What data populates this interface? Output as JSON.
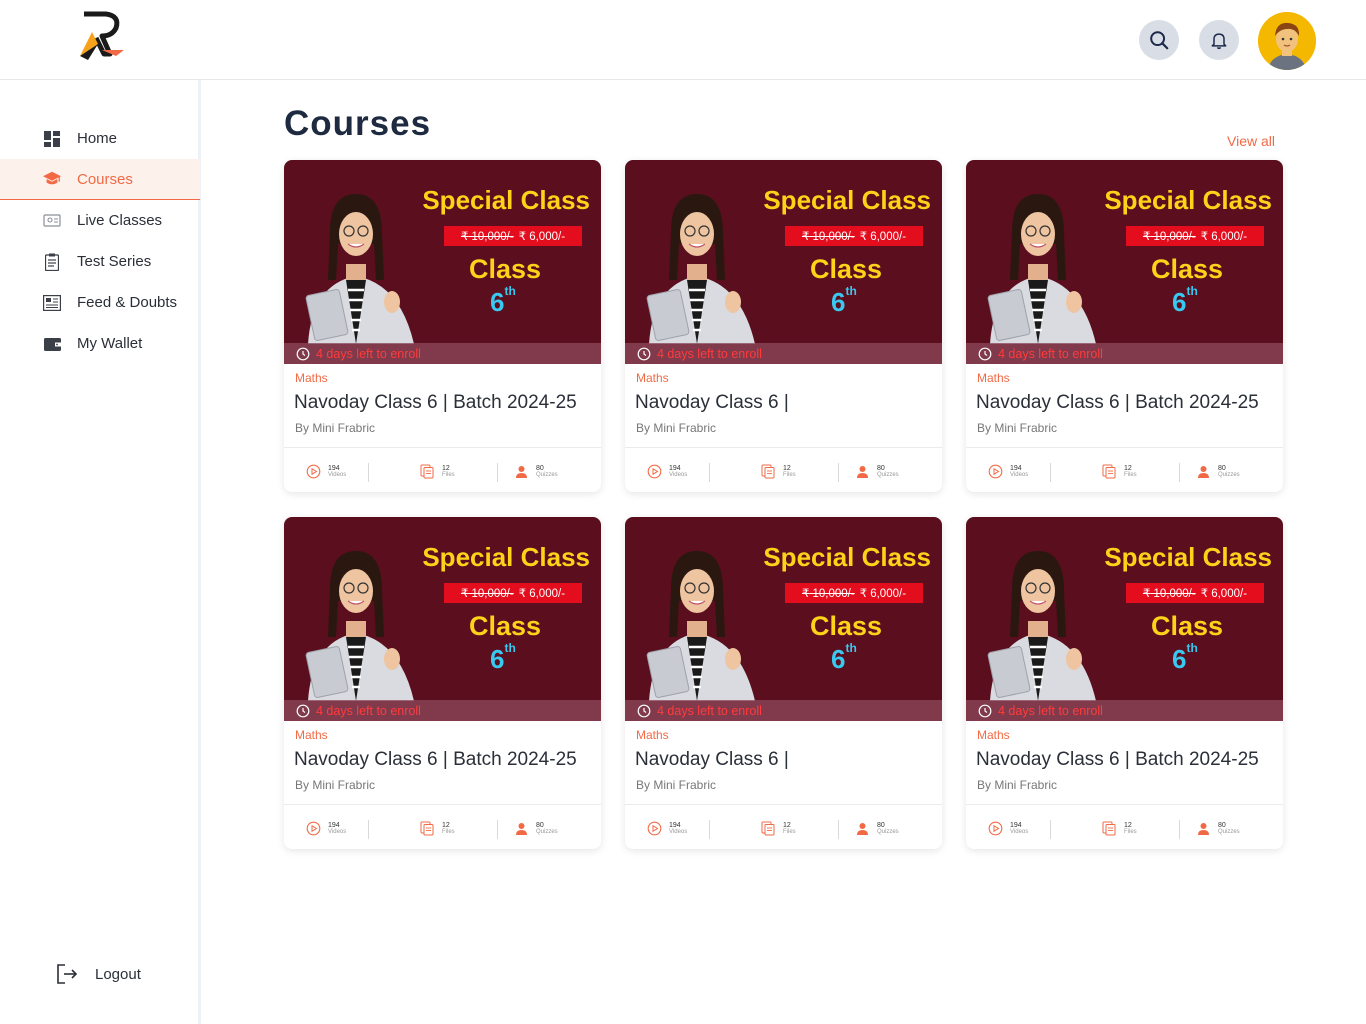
{
  "header": {
    "logo": "brand-logo",
    "search_icon": "search-icon",
    "bell_icon": "bell-icon"
  },
  "sidebar": {
    "items": [
      {
        "label": "Home",
        "icon": "dashboard-icon"
      },
      {
        "label": "Courses",
        "icon": "graduation-cap-icon",
        "active": true
      },
      {
        "label": "Live Classes",
        "icon": "live-classes-icon"
      },
      {
        "label": "Test Series",
        "icon": "clipboard-icon"
      },
      {
        "label": "Feed & Doubts",
        "icon": "newspaper-icon"
      },
      {
        "label": "My Wallet",
        "icon": "wallet-icon"
      }
    ],
    "logout_label": "Logout"
  },
  "main": {
    "title": "Courses",
    "view_all": "View all",
    "accent": "#f26a45"
  },
  "banner": {
    "special": "Special Class",
    "price_symbol": "₹",
    "old_price": "10,000/-",
    "new_price": "6,000/-",
    "class_word": "Class",
    "grade": "6",
    "grade_suffix": "th",
    "deadline": "4 days left to enroll"
  },
  "courses": [
    {
      "subject": "Maths",
      "title": "Navoday Class 6 | Batch 2024-25",
      "author": "By Mini Frabric",
      "videos": "194",
      "videos_label": "Videos",
      "files": "12",
      "files_label": "Files",
      "quizzes": "80",
      "quizzes_label": "Quizzes"
    },
    {
      "subject": "Maths",
      "title": "Navoday Class 6 |",
      "author": "By Mini Frabric",
      "videos": "194",
      "videos_label": "Videos",
      "files": "12",
      "files_label": "Files",
      "quizzes": "80",
      "quizzes_label": "Quizzes"
    },
    {
      "subject": "Maths",
      "title": "Navoday Class 6 | Batch 2024-25",
      "author": "By Mini Frabric",
      "videos": "194",
      "videos_label": "Videos",
      "files": "12",
      "files_label": "Files",
      "quizzes": "80",
      "quizzes_label": "Quizzes"
    },
    {
      "subject": "Maths",
      "title": "Navoday Class 6 | Batch 2024-25",
      "author": "By Mini Frabric",
      "videos": "194",
      "videos_label": "Videos",
      "files": "12",
      "files_label": "Files",
      "quizzes": "80",
      "quizzes_label": "Quizzes"
    },
    {
      "subject": "Maths",
      "title": "Navoday Class 6 |",
      "author": "By Mini Frabric",
      "videos": "194",
      "videos_label": "Videos",
      "files": "12",
      "files_label": "Files",
      "quizzes": "80",
      "quizzes_label": "Quizzes"
    },
    {
      "subject": "Maths",
      "title": "Navoday Class 6 | Batch 2024-25",
      "author": "By Mini Frabric",
      "videos": "194",
      "videos_label": "Videos",
      "files": "12",
      "files_label": "Files",
      "quizzes": "80",
      "quizzes_label": "Quizzes"
    }
  ]
}
